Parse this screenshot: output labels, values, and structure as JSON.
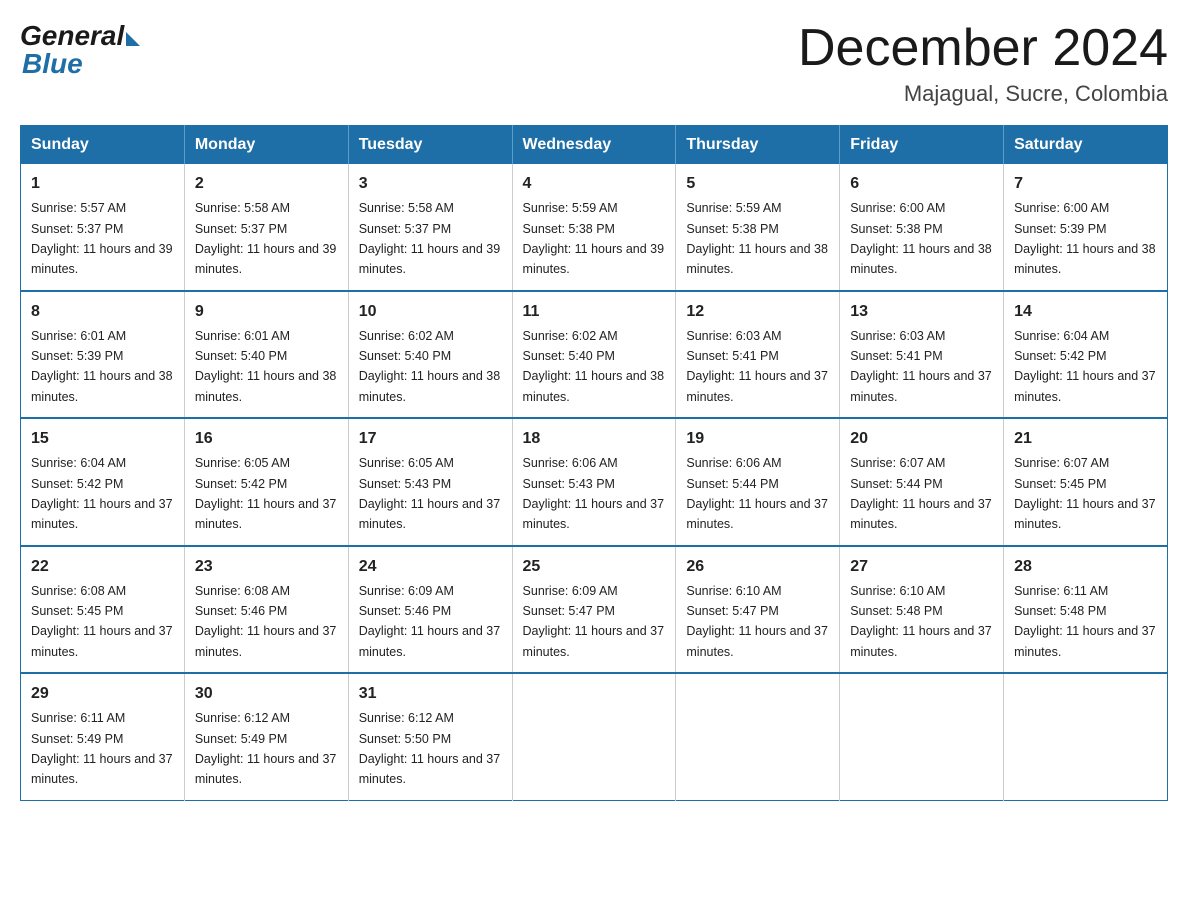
{
  "logo": {
    "general": "General",
    "blue": "Blue"
  },
  "title": {
    "month": "December 2024",
    "location": "Majagual, Sucre, Colombia"
  },
  "headers": [
    "Sunday",
    "Monday",
    "Tuesday",
    "Wednesday",
    "Thursday",
    "Friday",
    "Saturday"
  ],
  "weeks": [
    [
      {
        "day": "1",
        "sunrise": "5:57 AM",
        "sunset": "5:37 PM",
        "daylight": "11 hours and 39 minutes."
      },
      {
        "day": "2",
        "sunrise": "5:58 AM",
        "sunset": "5:37 PM",
        "daylight": "11 hours and 39 minutes."
      },
      {
        "day": "3",
        "sunrise": "5:58 AM",
        "sunset": "5:37 PM",
        "daylight": "11 hours and 39 minutes."
      },
      {
        "day": "4",
        "sunrise": "5:59 AM",
        "sunset": "5:38 PM",
        "daylight": "11 hours and 39 minutes."
      },
      {
        "day": "5",
        "sunrise": "5:59 AM",
        "sunset": "5:38 PM",
        "daylight": "11 hours and 38 minutes."
      },
      {
        "day": "6",
        "sunrise": "6:00 AM",
        "sunset": "5:38 PM",
        "daylight": "11 hours and 38 minutes."
      },
      {
        "day": "7",
        "sunrise": "6:00 AM",
        "sunset": "5:39 PM",
        "daylight": "11 hours and 38 minutes."
      }
    ],
    [
      {
        "day": "8",
        "sunrise": "6:01 AM",
        "sunset": "5:39 PM",
        "daylight": "11 hours and 38 minutes."
      },
      {
        "day": "9",
        "sunrise": "6:01 AM",
        "sunset": "5:40 PM",
        "daylight": "11 hours and 38 minutes."
      },
      {
        "day": "10",
        "sunrise": "6:02 AM",
        "sunset": "5:40 PM",
        "daylight": "11 hours and 38 minutes."
      },
      {
        "day": "11",
        "sunrise": "6:02 AM",
        "sunset": "5:40 PM",
        "daylight": "11 hours and 38 minutes."
      },
      {
        "day": "12",
        "sunrise": "6:03 AM",
        "sunset": "5:41 PM",
        "daylight": "11 hours and 37 minutes."
      },
      {
        "day": "13",
        "sunrise": "6:03 AM",
        "sunset": "5:41 PM",
        "daylight": "11 hours and 37 minutes."
      },
      {
        "day": "14",
        "sunrise": "6:04 AM",
        "sunset": "5:42 PM",
        "daylight": "11 hours and 37 minutes."
      }
    ],
    [
      {
        "day": "15",
        "sunrise": "6:04 AM",
        "sunset": "5:42 PM",
        "daylight": "11 hours and 37 minutes."
      },
      {
        "day": "16",
        "sunrise": "6:05 AM",
        "sunset": "5:42 PM",
        "daylight": "11 hours and 37 minutes."
      },
      {
        "day": "17",
        "sunrise": "6:05 AM",
        "sunset": "5:43 PM",
        "daylight": "11 hours and 37 minutes."
      },
      {
        "day": "18",
        "sunrise": "6:06 AM",
        "sunset": "5:43 PM",
        "daylight": "11 hours and 37 minutes."
      },
      {
        "day": "19",
        "sunrise": "6:06 AM",
        "sunset": "5:44 PM",
        "daylight": "11 hours and 37 minutes."
      },
      {
        "day": "20",
        "sunrise": "6:07 AM",
        "sunset": "5:44 PM",
        "daylight": "11 hours and 37 minutes."
      },
      {
        "day": "21",
        "sunrise": "6:07 AM",
        "sunset": "5:45 PM",
        "daylight": "11 hours and 37 minutes."
      }
    ],
    [
      {
        "day": "22",
        "sunrise": "6:08 AM",
        "sunset": "5:45 PM",
        "daylight": "11 hours and 37 minutes."
      },
      {
        "day": "23",
        "sunrise": "6:08 AM",
        "sunset": "5:46 PM",
        "daylight": "11 hours and 37 minutes."
      },
      {
        "day": "24",
        "sunrise": "6:09 AM",
        "sunset": "5:46 PM",
        "daylight": "11 hours and 37 minutes."
      },
      {
        "day": "25",
        "sunrise": "6:09 AM",
        "sunset": "5:47 PM",
        "daylight": "11 hours and 37 minutes."
      },
      {
        "day": "26",
        "sunrise": "6:10 AM",
        "sunset": "5:47 PM",
        "daylight": "11 hours and 37 minutes."
      },
      {
        "day": "27",
        "sunrise": "6:10 AM",
        "sunset": "5:48 PM",
        "daylight": "11 hours and 37 minutes."
      },
      {
        "day": "28",
        "sunrise": "6:11 AM",
        "sunset": "5:48 PM",
        "daylight": "11 hours and 37 minutes."
      }
    ],
    [
      {
        "day": "29",
        "sunrise": "6:11 AM",
        "sunset": "5:49 PM",
        "daylight": "11 hours and 37 minutes."
      },
      {
        "day": "30",
        "sunrise": "6:12 AM",
        "sunset": "5:49 PM",
        "daylight": "11 hours and 37 minutes."
      },
      {
        "day": "31",
        "sunrise": "6:12 AM",
        "sunset": "5:50 PM",
        "daylight": "11 hours and 37 minutes."
      },
      null,
      null,
      null,
      null
    ]
  ],
  "labels": {
    "sunrise": "Sunrise: ",
    "sunset": "Sunset: ",
    "daylight": "Daylight: "
  }
}
